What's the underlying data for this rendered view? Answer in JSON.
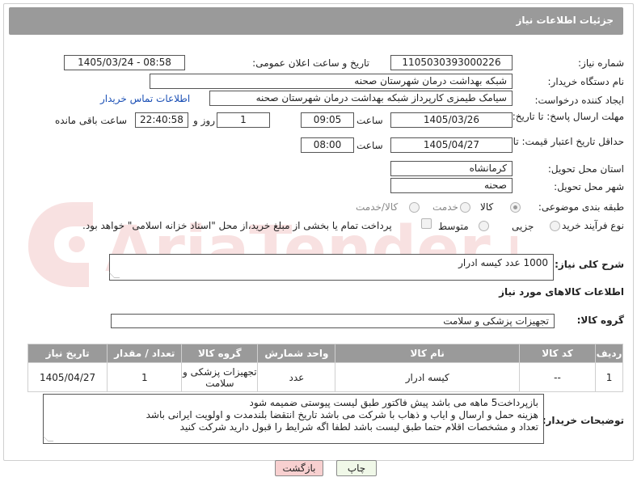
{
  "header": {
    "title": "جزئیات اطلاعات نیاز"
  },
  "fields": {
    "need_number": {
      "label": "شماره نیاز:",
      "value": "1105030393000226"
    },
    "announce": {
      "label": "تاریخ و ساعت اعلان عمومی:",
      "value": "1405/03/24 - 08:58"
    },
    "buyer_org": {
      "label": "نام دستگاه خریدار:",
      "value": "شبکه بهداشت درمان شهرستان صحنه"
    },
    "creator": {
      "label": "ایجاد کننده درخواست:",
      "value": "سیامک طیمزی کارپرداز شبکه بهداشت درمان شهرستان صحنه",
      "contact_link": "اطلاعات تماس خریدار"
    },
    "deadline": {
      "label": "مهلت ارسال پاسخ: تا تاریخ:",
      "date": "1405/03/26",
      "time_label": "ساعت",
      "time": "09:05",
      "days": "1",
      "days_label": "روز و",
      "remaining": "22:40:58",
      "remaining_label": "ساعت باقی مانده"
    },
    "price_validity": {
      "label": "حداقل تاریخ اعتبار قیمت: تا تاریخ:",
      "date": "1405/04/27",
      "time_label": "ساعت",
      "time": "08:00"
    },
    "province": {
      "label": "استان محل تحویل:",
      "value": "کرمانشاه"
    },
    "city": {
      "label": "شهر محل تحویل:",
      "value": "صحنه"
    },
    "category": {
      "label": "طبقه بندی موضوعی:",
      "options": [
        "کالا",
        "خدمت",
        "کالا/خدمت"
      ],
      "selected": "کالا"
    },
    "process": {
      "label": "نوع فرآیند خرید :",
      "options": [
        "جزیی",
        "متوسط"
      ],
      "selected": "جزیی",
      "payment_note": "پرداخت تمام یا بخشی از مبلغ خرید،از محل \"اسناد خزانه اسلامی\" خواهد بود."
    }
  },
  "description": {
    "label": "شرح کلی نیاز:",
    "value": "1000 عدد کیسه ادرار"
  },
  "goods_info": {
    "title": "اطلاعات کالاهای مورد نیاز"
  },
  "goods_group": {
    "label": "گروه کالا:",
    "value": "تجهیزات پزشکی و سلامت"
  },
  "table": {
    "headers": [
      "ردیف",
      "کد کالا",
      "نام کالا",
      "واحد شمارش",
      "گروه کالا",
      "تعداد / مقدار",
      "تاریخ نیاز"
    ],
    "rows": [
      {
        "row": "1",
        "code": "--",
        "name": "کیسه ادرار",
        "unit": "عدد",
        "group": "تجهیزات پزشکی و سلامت",
        "qty": "1",
        "date": "1405/04/27"
      }
    ]
  },
  "buyer_notes": {
    "label": "توضیحات خریدار:",
    "lines": [
      "بازپرداخت5 ماهه می باشد پیش فاکتور طبق لیست پیوستی ضمیمه شود",
      "هزینه حمل و ارسال و ایاب و ذهاب با شرکت می باشد تاریخ انتقضا بلندمدت و اولویت ایرانی باشد",
      "تعداد و مشخصات اقلام حتما طبق لیست باشد  لطفا اگه شرایط را قبول دارید شرکت کنید"
    ]
  },
  "buttons": {
    "print": "چاپ",
    "back": "بازگشت"
  },
  "watermark": {
    "text": "AriaTender.net"
  },
  "colors": {
    "header_bg": "#9a9a9a",
    "link": "#1a4fb5",
    "back_button": "#f8d0d0",
    "print_button": "#f0f8e8"
  }
}
